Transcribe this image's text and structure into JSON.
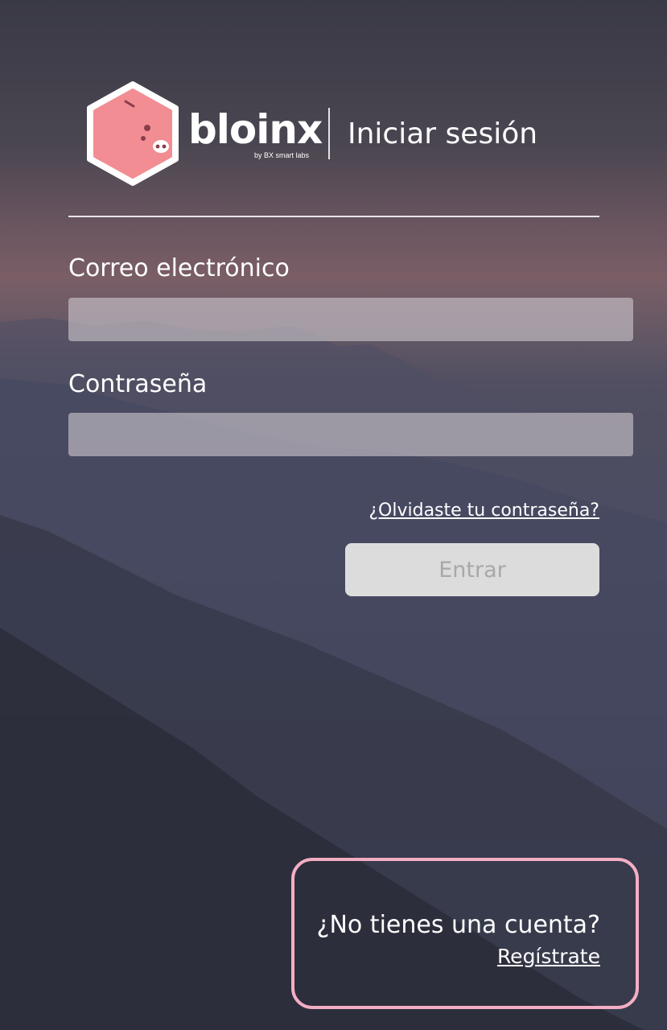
{
  "header": {
    "logo_icon": "piggy-bank-hex-icon",
    "brand_name": "bloinx",
    "brand_sub": "by BX smart labs",
    "title": "Iniciar sesión"
  },
  "form": {
    "email_label": "Correo electrónico",
    "email_value": "",
    "password_label": "Contraseña",
    "password_value": "",
    "forgot_link": "¿Olvidaste tu contraseña?",
    "submit_label": "Entrar"
  },
  "register": {
    "question": "¿No tienes una cuenta?",
    "link": "Regístrate"
  },
  "colors": {
    "logo_pink": "#f18d93",
    "highlight_border": "#f4aec4",
    "button_bg": "#dcdcdc",
    "button_text": "#a8a8a8"
  }
}
